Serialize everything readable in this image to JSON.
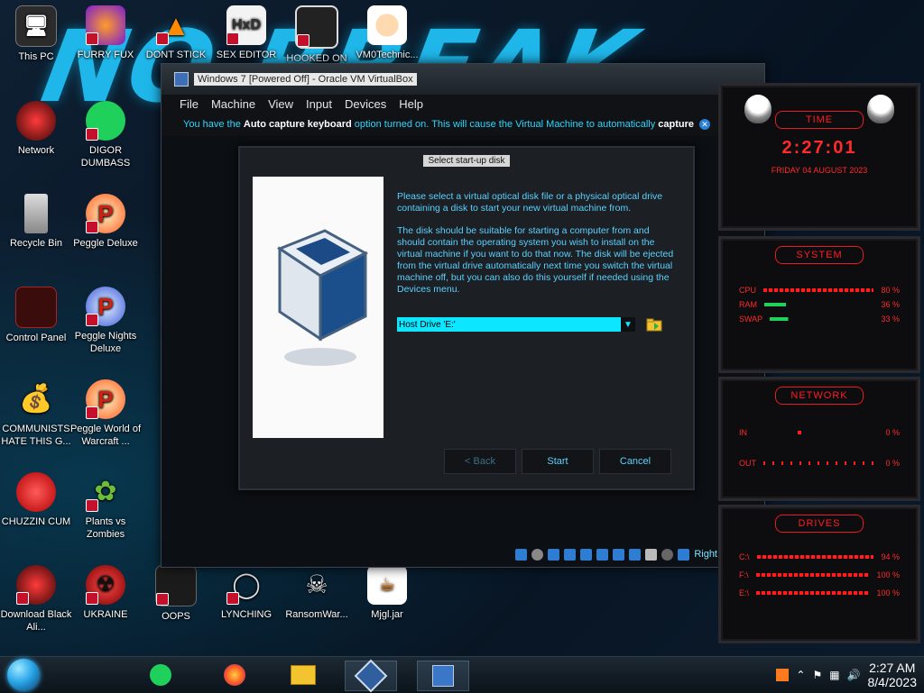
{
  "desktop": {
    "icons": [
      {
        "label": "This PC"
      },
      {
        "label": "FURRY FUX"
      },
      {
        "label": "DONT STICK"
      },
      {
        "label": "SEX EDITOR"
      },
      {
        "label": "HOOKED ON"
      },
      {
        "label": "VM0Technic..."
      },
      {
        "label": "Network"
      },
      {
        "label": "DIGOR DUMBASS"
      },
      {
        "label": "Recycle Bin"
      },
      {
        "label": "Peggle Deluxe"
      },
      {
        "label": "Control Panel"
      },
      {
        "label": "Peggle Nights Deluxe"
      },
      {
        "label": "COMMUNISTS HATE THIS G..."
      },
      {
        "label": "Peggle World of Warcraft ..."
      },
      {
        "label": "CHUZZIN CUM"
      },
      {
        "label": "Plants vs Zombies"
      },
      {
        "label": "Download Black Ali..."
      },
      {
        "label": "UKRAINE"
      },
      {
        "label": "OOPS"
      },
      {
        "label": "LYNCHING"
      },
      {
        "label": "RansomWar..."
      },
      {
        "label": "Mjgl.jar"
      }
    ]
  },
  "vbox": {
    "title": "Windows 7 [Powered Off] - Oracle VM VirtualBox",
    "menu": [
      "File",
      "Machine",
      "View",
      "Input",
      "Devices",
      "Help"
    ],
    "notice_prefix": "You have the ",
    "notice_bold": "Auto capture keyboard",
    "notice_suffix": " option turned on. This will cause the Virtual Machine to automatically ",
    "notice_capture": "capture",
    "status_host_key": "Right"
  },
  "dialog": {
    "title": "Select start-up disk",
    "para1": "Please select a virtual optical disk file or a physical optical drive containing a disk to start your new virtual machine from.",
    "para2": "The disk should be suitable for starting a computer from and should contain the operating system you wish to install on the virtual machine if you want to do that now. The disk will be ejected from the virtual drive automatically next time you switch the virtual machine off, but you can also do this yourself if needed using the Devices menu.",
    "combo_value": "Host Drive 'E:'",
    "buttons": {
      "back": "< Back",
      "start": "Start",
      "cancel": "Cancel"
    }
  },
  "widgets": {
    "time": {
      "head": "TIME",
      "clock": "2:27:01",
      "date": "FRIDAY 04 AUGUST 2023"
    },
    "system": {
      "head": "SYSTEM",
      "rows": [
        {
          "label": "CPU",
          "value": "80 %"
        },
        {
          "label": "RAM",
          "value": "36 %"
        },
        {
          "label": "SWAP",
          "value": "33 %"
        }
      ]
    },
    "network": {
      "head": "NETWORK",
      "rows": [
        {
          "label": "IN",
          "value": "0 %"
        },
        {
          "label": "OUT",
          "value": "0 %"
        }
      ]
    },
    "drives": {
      "head": "DRIVES",
      "rows": [
        {
          "label": "C:\\",
          "value": "94 %"
        },
        {
          "label": "F:\\",
          "value": "100 %"
        },
        {
          "label": "E:\\",
          "value": "100 %"
        }
      ]
    }
  },
  "taskbar": {
    "time": "2:27 AM",
    "date": "8/4/2023"
  },
  "colors": {
    "accent_cyan": "#2ad8ff",
    "widget_red": "#ff1c24",
    "combo_highlight": "#0ce6ff"
  }
}
